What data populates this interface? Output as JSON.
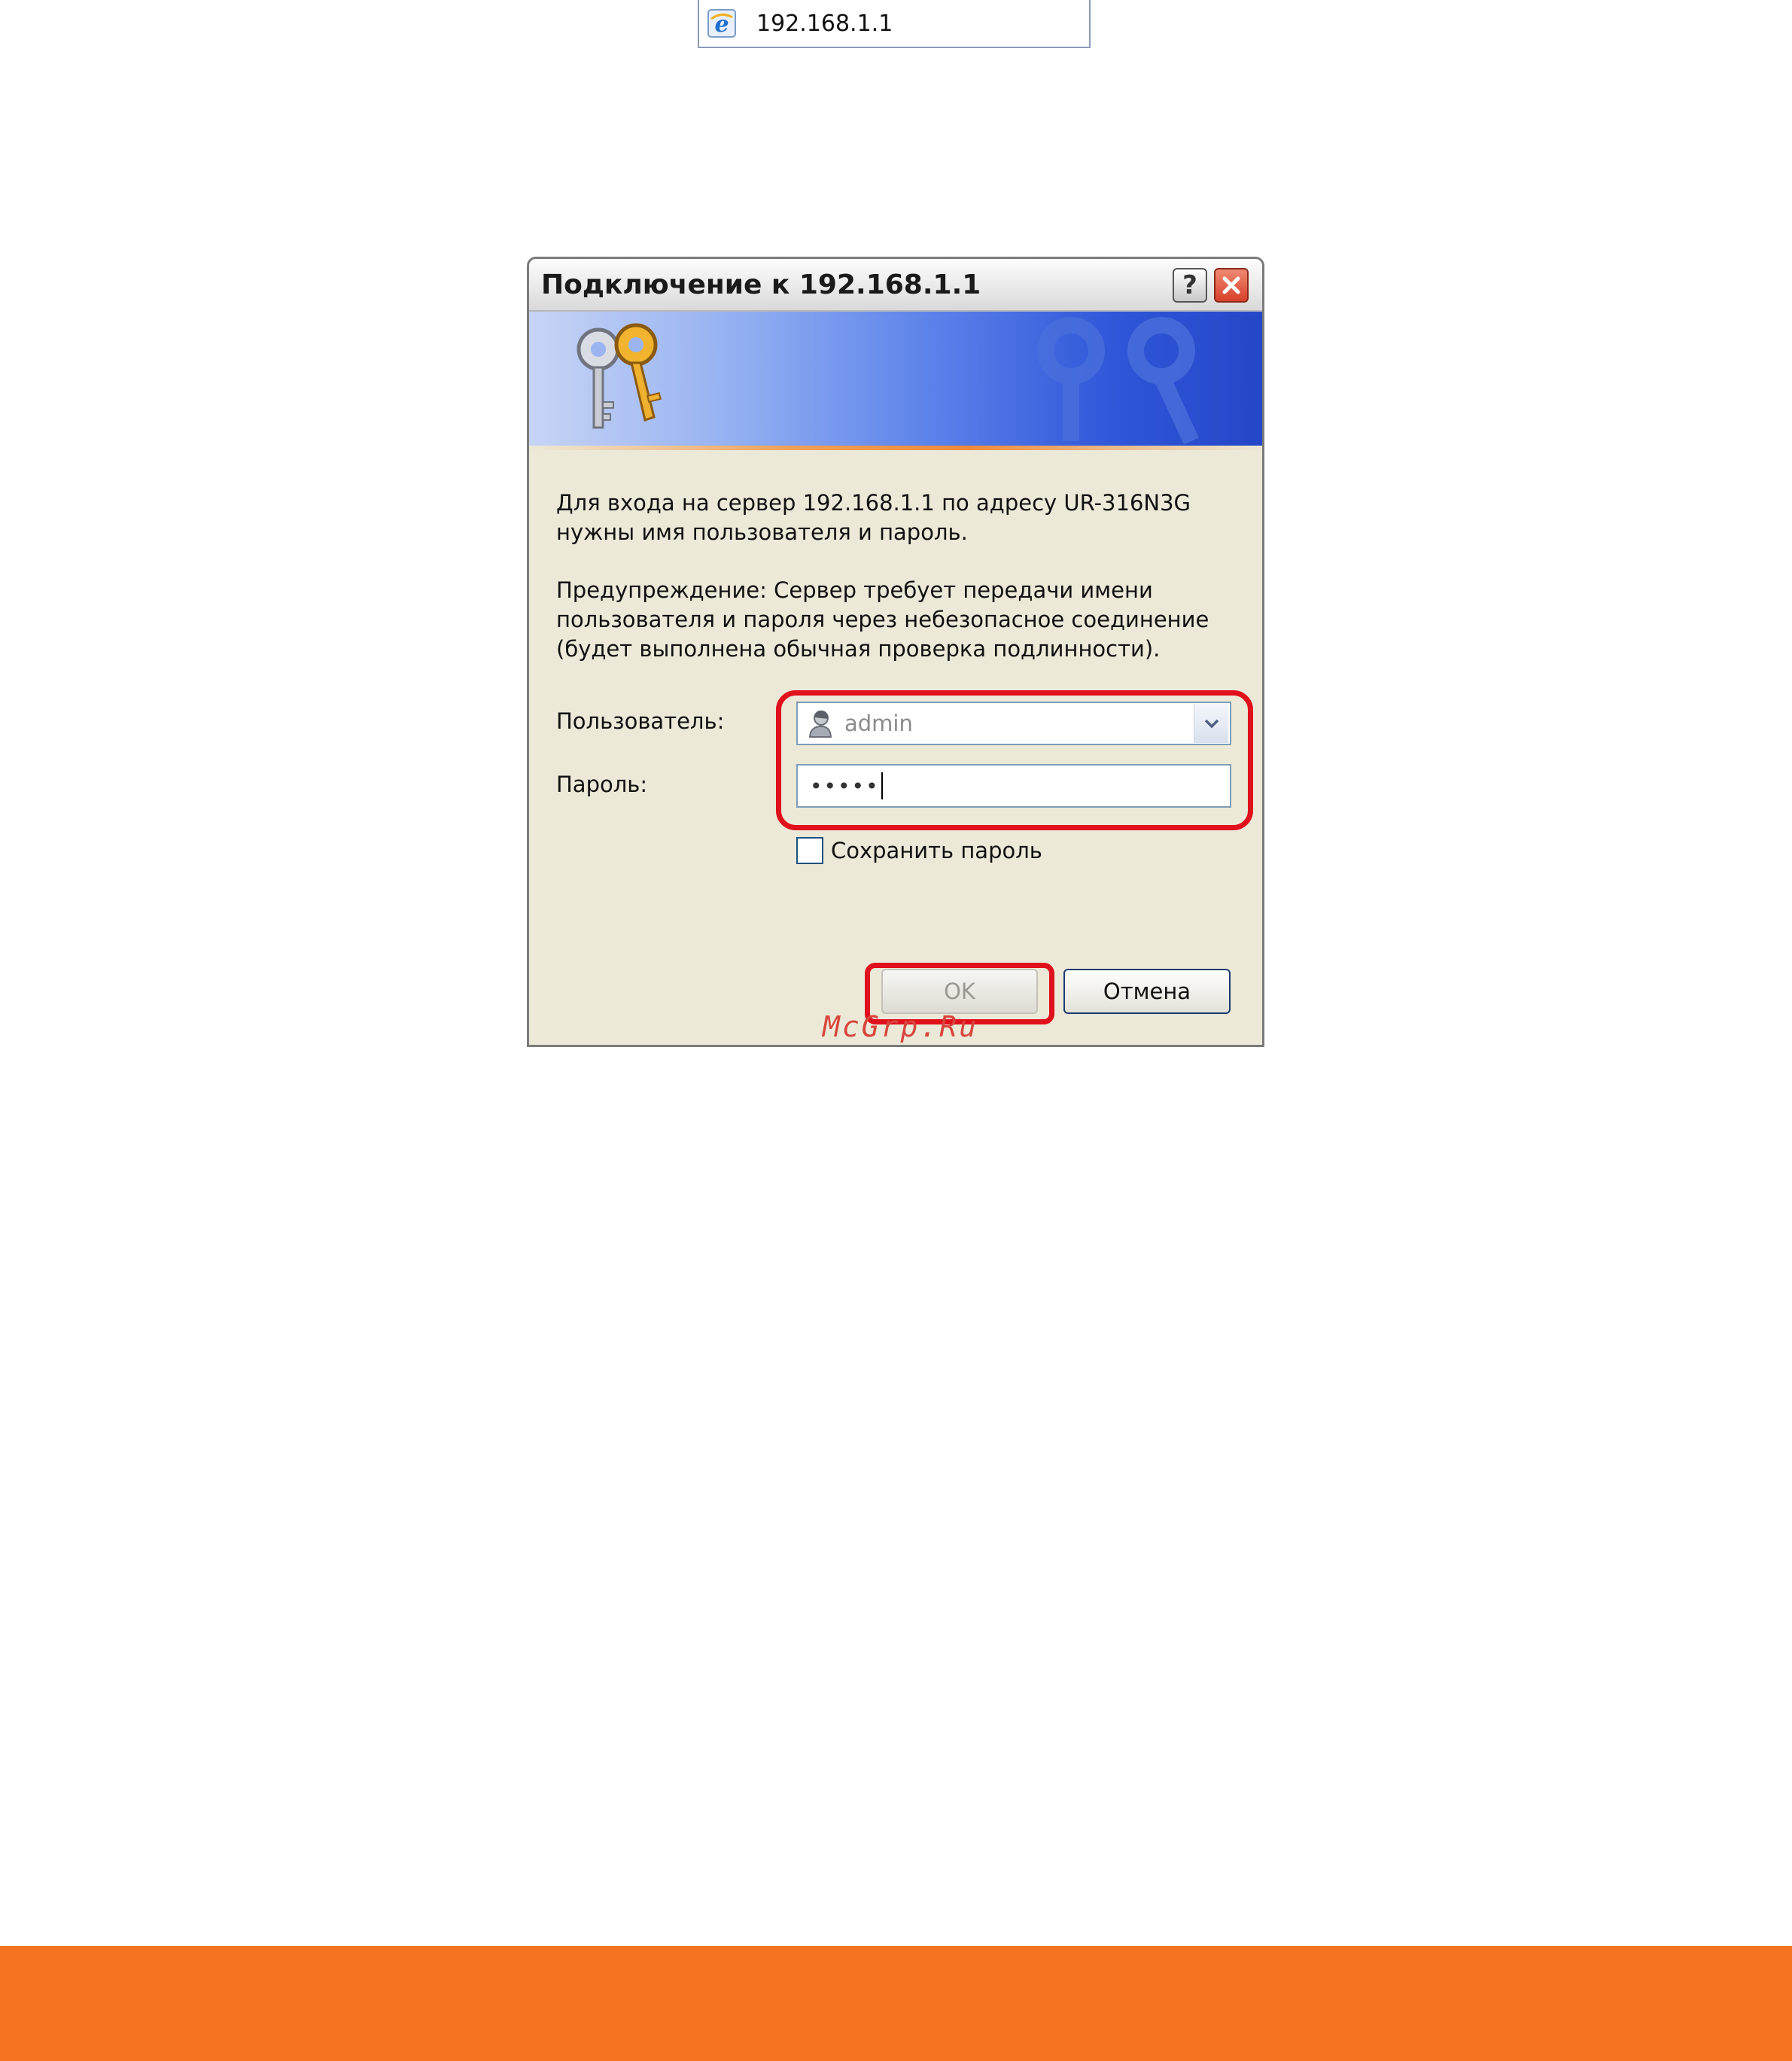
{
  "address_bar": {
    "url": "192.168.1.1",
    "icon": "ie-icon"
  },
  "dialog": {
    "title": "Подключение к 192.168.1.1",
    "help_label": "?",
    "banner_icon": "keys-icon",
    "message": "Для входа на сервер 192.168.1.1 по адресу UR-316N3G\nнужны имя пользователя и пароль.",
    "warning": "Предупреждение: Сервер требует передачи имени\nпользователя и пароля через небезопасное соединение\n(будет выполнена обычная проверка подлинности).",
    "user_label": "Пользователь:",
    "user_value": "admin",
    "password_label": "Пароль:",
    "password_value": "•••••",
    "save_password_label": "Сохранить пароль",
    "save_password_checked": false,
    "ok_label": "OK",
    "cancel_label": "Отмена"
  },
  "watermark": "McGrp.Ru",
  "colors": {
    "highlight": "#e0101c",
    "footer": "#f47321",
    "watermark": "#d8453c"
  }
}
